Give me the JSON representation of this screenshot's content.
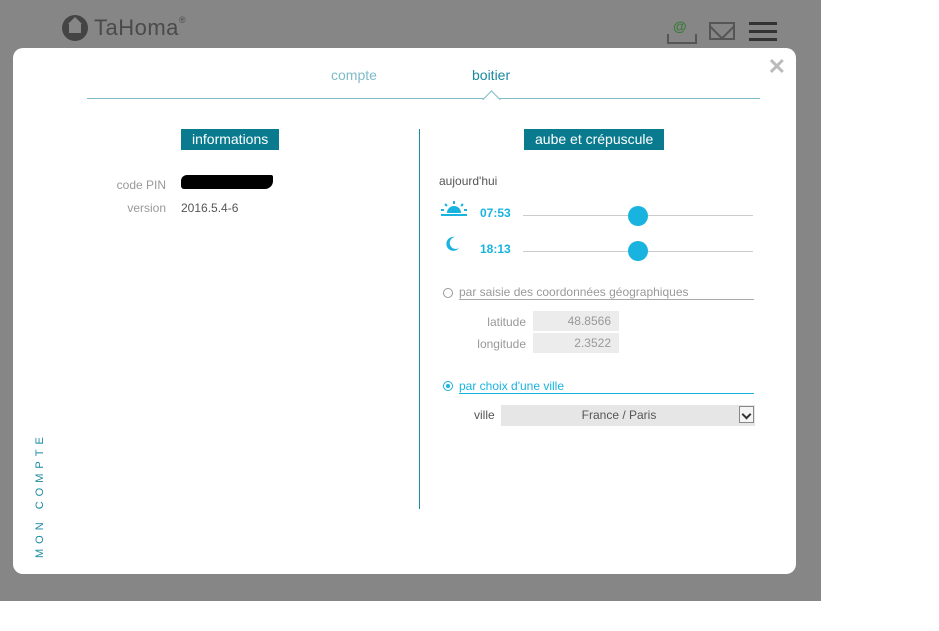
{
  "app": {
    "name": "TaHoma",
    "registered_mark": "®"
  },
  "header_icons": {
    "account": "at-icon",
    "messages": "mail-icon",
    "menu": "menu-icon",
    "at_symbol": "@"
  },
  "modal": {
    "close_glyph": "✕",
    "side_title": "MON COMPTE",
    "tabs": [
      {
        "label": "compte",
        "active": false
      },
      {
        "label": "boitier",
        "active": true
      }
    ],
    "informations": {
      "title": "informations",
      "pin_label": "code PIN",
      "pin_value": "",
      "version_label": "version",
      "version_value": "2016.5.4-6"
    },
    "aube": {
      "title": "aube et crépuscule",
      "today_label": "aujourd'hui",
      "sunrise_time": "07:53",
      "sunset_time": "18:13",
      "option_coords_label": "par saisie des coordonnées géographiques",
      "option_coords_selected": false,
      "latitude_label": "latitude",
      "latitude_value": "48.8566",
      "longitude_label": "longitude",
      "longitude_value": "2.3522",
      "option_city_label": "par choix d'une ville",
      "option_city_selected": true,
      "city_label": "ville",
      "city_value": "France / Paris"
    }
  },
  "colors": {
    "accent": "#19b3e0",
    "section_badge": "#0a7b8f",
    "tab_active": "#1a8aa0",
    "tab_inactive": "#7dbcc8",
    "backdrop": "#868686"
  }
}
